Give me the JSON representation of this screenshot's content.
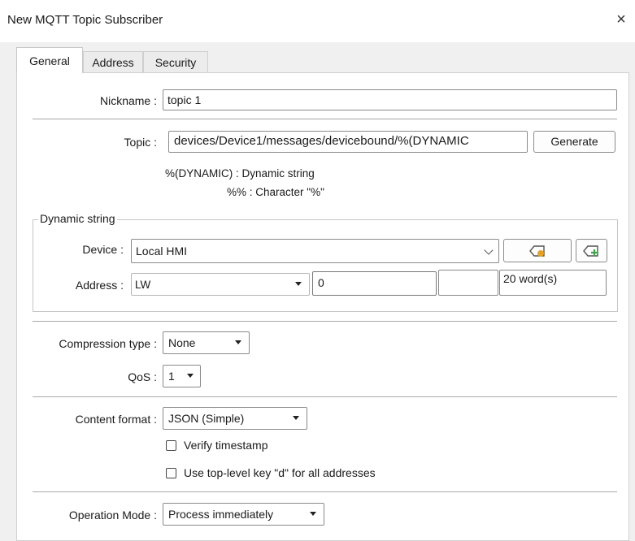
{
  "window": {
    "title": "New MQTT Topic Subscriber",
    "close_glyph": "×"
  },
  "tabs": [
    {
      "label": "General",
      "active": true
    },
    {
      "label": "Address",
      "active": false
    },
    {
      "label": "Security",
      "active": false
    }
  ],
  "nickname": {
    "label": "Nickname :",
    "value": "topic 1"
  },
  "topic": {
    "label": "Topic :",
    "value": "devices/Device1/messages/devicebound/%(DYNAMIC",
    "generate_label": "Generate",
    "hint_dynamic": "%(DYNAMIC) : Dynamic string",
    "hint_percent": "%% : Character \"%\""
  },
  "dynamic_string": {
    "legend": "Dynamic string",
    "device_label": "Device :",
    "device_value": "Local HMI",
    "address_label": "Address :",
    "address_type": "LW",
    "address_value": "0",
    "address_extra": "",
    "length": "20 word(s)"
  },
  "compression": {
    "label": "Compression type :",
    "value": "None"
  },
  "qos": {
    "label": "QoS :",
    "value": "1"
  },
  "content_format": {
    "label": "Content format :",
    "value": "JSON (Simple)",
    "verify_timestamp_label": "Verify timestamp",
    "verify_timestamp_checked": false,
    "top_level_key_label": "Use top-level key \"d\" for all addresses",
    "top_level_key_checked": false
  },
  "operation_mode": {
    "label": "Operation Mode :",
    "value": "Process immediately"
  },
  "colors": {
    "accent_orange": "#e8a020",
    "accent_green": "#3aa84a"
  }
}
